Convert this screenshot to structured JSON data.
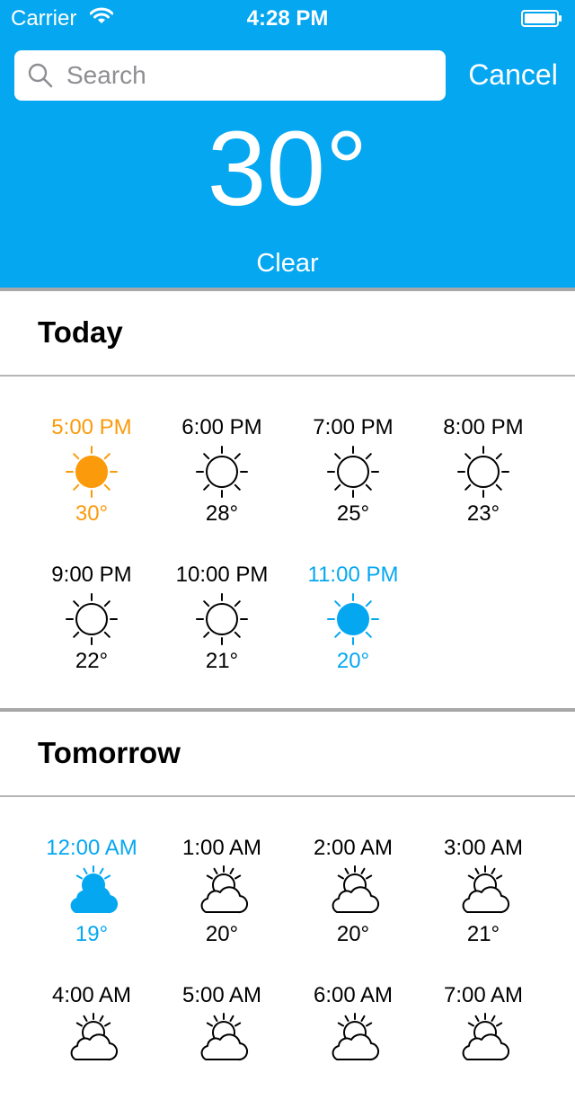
{
  "status_bar": {
    "carrier": "Carrier",
    "time": "4:28 PM"
  },
  "search": {
    "placeholder": "Search",
    "value": "",
    "cancel_label": "Cancel"
  },
  "current": {
    "temperature": "30°",
    "condition": "Clear"
  },
  "colors": {
    "header_bg": "#05a7f1",
    "highlight_orange": "#fb9a0b",
    "highlight_blue": "#05a7f1"
  },
  "sections": [
    {
      "title": "Today",
      "hours": [
        {
          "time": "5:00 PM",
          "temp": "30°",
          "icon": "sun-icon",
          "highlight": "orange"
        },
        {
          "time": "6:00 PM",
          "temp": "28°",
          "icon": "sun-icon",
          "highlight": "none"
        },
        {
          "time": "7:00 PM",
          "temp": "25°",
          "icon": "sun-icon",
          "highlight": "none"
        },
        {
          "time": "8:00 PM",
          "temp": "23°",
          "icon": "sun-icon",
          "highlight": "none"
        },
        {
          "time": "9:00 PM",
          "temp": "22°",
          "icon": "sun-icon",
          "highlight": "none"
        },
        {
          "time": "10:00 PM",
          "temp": "21°",
          "icon": "sun-icon",
          "highlight": "none"
        },
        {
          "time": "11:00 PM",
          "temp": "20°",
          "icon": "sun-icon",
          "highlight": "blue"
        }
      ]
    },
    {
      "title": "Tomorrow",
      "hours": [
        {
          "time": "12:00 AM",
          "temp": "19°",
          "icon": "partly-cloudy-icon",
          "highlight": "blue"
        },
        {
          "time": "1:00 AM",
          "temp": "20°",
          "icon": "partly-cloudy-icon",
          "highlight": "none"
        },
        {
          "time": "2:00 AM",
          "temp": "20°",
          "icon": "partly-cloudy-icon",
          "highlight": "none"
        },
        {
          "time": "3:00 AM",
          "temp": "21°",
          "icon": "partly-cloudy-icon",
          "highlight": "none"
        },
        {
          "time": "4:00 AM",
          "temp": "",
          "icon": "partly-cloudy-icon",
          "highlight": "none"
        },
        {
          "time": "5:00 AM",
          "temp": "",
          "icon": "partly-cloudy-icon",
          "highlight": "none"
        },
        {
          "time": "6:00 AM",
          "temp": "",
          "icon": "partly-cloudy-icon",
          "highlight": "none"
        },
        {
          "time": "7:00 AM",
          "temp": "",
          "icon": "partly-cloudy-icon",
          "highlight": "none"
        }
      ]
    }
  ]
}
